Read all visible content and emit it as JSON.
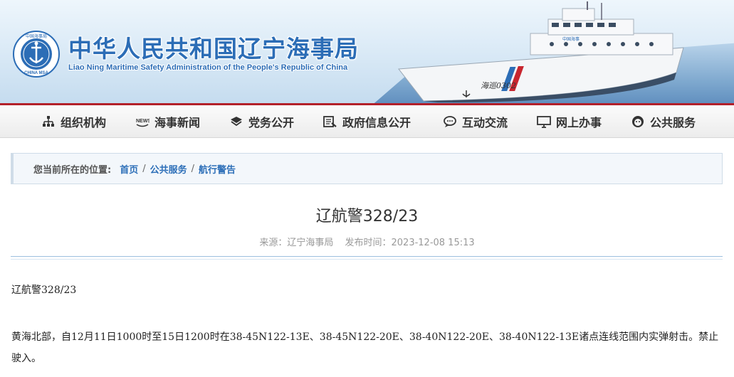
{
  "header": {
    "title_cn": "中华人民共和国辽宁海事局",
    "title_en": "Liao Ning Maritime Safety Administration of the People's Republic of China",
    "emblem_text_top": "中国海事局",
    "emblem_text_bottom": "CHINA MSA",
    "ship_label": "海巡0302",
    "ship_hull_label": "中国海事"
  },
  "nav": {
    "items": [
      {
        "label": "组织机构",
        "icon": "org-chart-icon"
      },
      {
        "label": "海事新闻",
        "icon": "news-icon"
      },
      {
        "label": "党务公开",
        "icon": "book-icon"
      },
      {
        "label": "政府信息公开",
        "icon": "document-icon"
      },
      {
        "label": "互动交流",
        "icon": "chat-icon"
      },
      {
        "label": "网上办事",
        "icon": "monitor-icon"
      },
      {
        "label": "公共服务",
        "icon": "person-icon"
      }
    ]
  },
  "breadcrumb": {
    "prefix": "您当前所在的位置:",
    "items": [
      "首页",
      "公共服务",
      "航行警告"
    ],
    "separator": "/"
  },
  "article": {
    "title": "辽航警328/23",
    "source": "来源：辽宁海事局",
    "published": "发布时间：2023-12-08 15:13",
    "paragraph1": "辽航警328/23",
    "paragraph2": "黄海北部，自12月11日1000时至15日1200时在38-45N122-13E、38-45N122-20E、38-40N122-20E、38-40N122-13E诸点连线范围内实弹射击。禁止驶入。"
  },
  "colors": {
    "brand_blue": "#2c6db6",
    "nav_red": "#b3202a",
    "link_blue": "#2d6fb8"
  }
}
